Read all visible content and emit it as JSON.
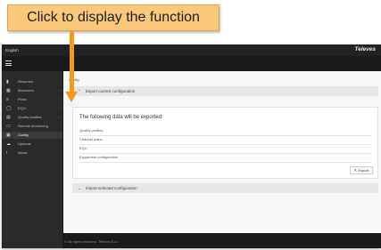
{
  "callout": {
    "text": "Click to display the function"
  },
  "topbar": {
    "language": "English",
    "brand": "Televes"
  },
  "sidebar": {
    "items": [
      {
        "label": "Resumen",
        "icon": "device-icon",
        "glyph": "▮",
        "has_chevron": false
      },
      {
        "label": "Measures",
        "icon": "chart-icon",
        "glyph": "▦",
        "has_chevron": true
      },
      {
        "label": "Plans",
        "icon": "list-icon",
        "glyph": "≡",
        "has_chevron": true
      },
      {
        "label": "EQU",
        "icon": "circle-icon",
        "glyph": "◯",
        "has_chevron": true
      },
      {
        "label": "Quality profiles",
        "icon": "profiles-icon",
        "glyph": "▤",
        "has_chevron": true
      },
      {
        "label": "Remote Monitoring",
        "icon": "monitor-icon",
        "glyph": "▭",
        "has_chevron": false
      },
      {
        "label": "Config",
        "icon": "config-icon",
        "glyph": "▣",
        "has_chevron": false,
        "active": true
      },
      {
        "label": "Uploads",
        "icon": "cloud-icon",
        "glyph": "☁",
        "has_chevron": false
      },
      {
        "label": "About",
        "icon": "info-icon",
        "glyph": "i",
        "has_chevron": false
      }
    ]
  },
  "main": {
    "breadcrumb": "Config",
    "export_section": {
      "header": "Export current configuration",
      "title": "The following data will be exported",
      "rows": [
        "Quality profiles",
        "Channel plans",
        "EQU",
        "Equipment configuration"
      ],
      "button": "Export"
    },
    "import_section": {
      "header": "Import selected configuration"
    }
  },
  "footer": {
    "text": "© All rights reserved. Televes S.a."
  }
}
